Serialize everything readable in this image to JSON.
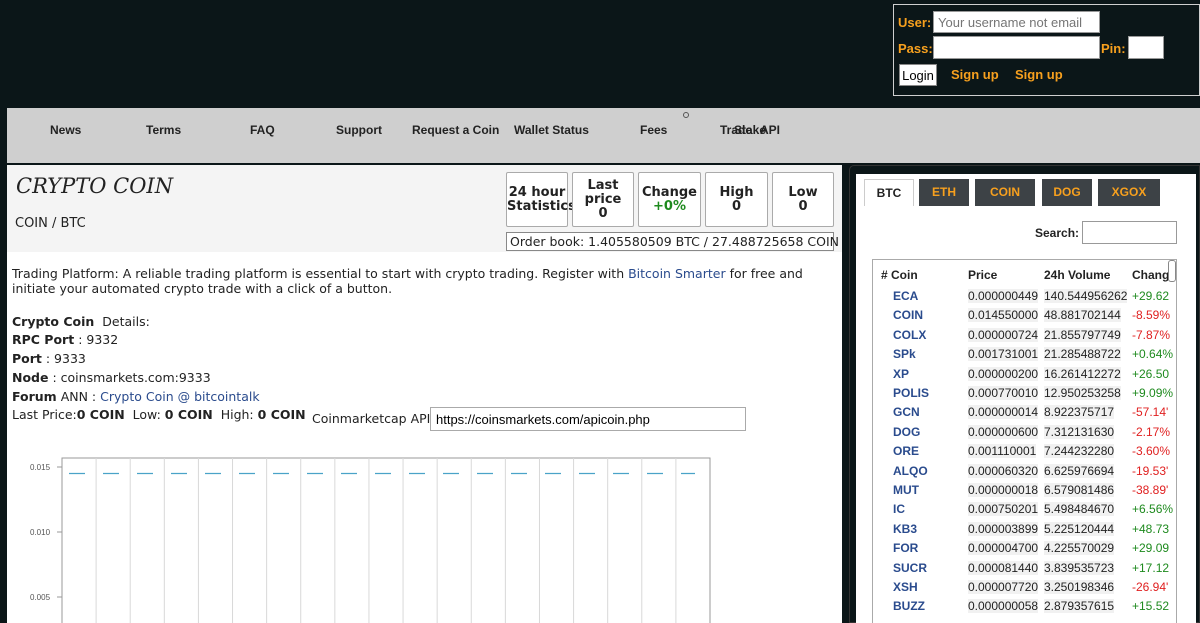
{
  "login": {
    "user_label": "User:",
    "user_placeholder": "Your username not email",
    "pass_label": "Pass:",
    "pin_label": "Pin:",
    "login_button": "Login",
    "signup_link_1": "Sign up",
    "signup_link_2": "Sign up"
  },
  "nav": {
    "items": [
      "News",
      "Terms",
      "FAQ",
      "Support",
      "Request a Coin",
      "Wallet Status",
      "Fees",
      "Trade",
      "Stake",
      "API"
    ]
  },
  "header": {
    "title": "CRYPTO COIN",
    "pair": "COIN / BTC",
    "stats": {
      "s24_line1": "24 hour",
      "s24_line2": "Statistics",
      "last_line1": "Last",
      "last_line2": "price",
      "last_value": "0",
      "change_label": "Change",
      "change_value": "+0%",
      "high_label": "High",
      "high_value": "0",
      "low_label": "Low",
      "low_value": "0"
    },
    "orderbook": "Order book: 1.405580509 BTC / 27.488725658 COIN"
  },
  "description": {
    "text_before": "Trading Platform: A reliable trading platform is essential to start with crypto trading. Register with ",
    "link": "Bitcoin Smarter",
    "text_after": " for free and initiate your automated crypto trade with a click of a button."
  },
  "details": {
    "coin_name": "Crypto Coin",
    "details_label": "Details:",
    "rpc_label": "RPC Port",
    "rpc_value": ": 9332",
    "port_label": "Port",
    "port_value": ": 9333",
    "node_label": "Node",
    "node_value": ": coinsmarkets.com:9333",
    "forum_label": "Forum",
    "forum_ann": "ANN :",
    "forum_link": "Crypto Coin @ bitcointalk",
    "last_price_label": "Last Price:",
    "last_price_value": "0 COIN",
    "low_label": "Low:",
    "low_value": "0 COIN",
    "high_label": "High:",
    "high_value": "0 COIN",
    "cmc_label": "Coinmarketcap API:",
    "cmc_value": "https://coinsmarkets.com/apicoin.php"
  },
  "chart_data": {
    "type": "line",
    "y_ticks": [
      "0.015",
      "0.010",
      "0.005"
    ],
    "ylim": [
      0.0,
      0.016
    ],
    "series": [
      {
        "values": [
          0.0145,
          0.0145
        ]
      }
    ],
    "colors": {
      "line": "#4aa3c8",
      "grid": "#d8d8d8"
    }
  },
  "market": {
    "tabs": [
      "BTC",
      "ETH",
      "COIN",
      "DOG",
      "XGOX"
    ],
    "active_tab": "BTC",
    "search_label": "Search:",
    "columns": [
      "# Coin",
      "Price",
      "24h Volume",
      "Chang"
    ],
    "rows": [
      {
        "coin": "ECA",
        "price": "0.000000449",
        "volume": "140.544956262",
        "change": "+29.62",
        "dir": "pos"
      },
      {
        "coin": "COIN",
        "price": "0.014550000",
        "volume": "48.881702144",
        "change": "-8.59%",
        "dir": "neg"
      },
      {
        "coin": "COLX",
        "price": "0.000000724",
        "volume": "21.855797749",
        "change": "-7.87%",
        "dir": "neg"
      },
      {
        "coin": "SPk",
        "price": "0.001731001",
        "volume": "21.285488722",
        "change": "+0.64%",
        "dir": "pos"
      },
      {
        "coin": "XP",
        "price": "0.000000200",
        "volume": "16.261412272",
        "change": "+26.50",
        "dir": "pos"
      },
      {
        "coin": "POLIS",
        "price": "0.000770010",
        "volume": "12.950253258",
        "change": "+9.09%",
        "dir": "pos"
      },
      {
        "coin": "GCN",
        "price": "0.000000014",
        "volume": "8.922375717",
        "change": "-57.14'",
        "dir": "neg"
      },
      {
        "coin": "DOG",
        "price": "0.000000600",
        "volume": "7.312131630",
        "change": "-2.17%",
        "dir": "neg"
      },
      {
        "coin": "ORE",
        "price": "0.001110001",
        "volume": "7.244232280",
        "change": "-3.60%",
        "dir": "neg"
      },
      {
        "coin": "ALQO",
        "price": "0.000060320",
        "volume": "6.625976694",
        "change": "-19.53'",
        "dir": "neg"
      },
      {
        "coin": "MUT",
        "price": "0.000000018",
        "volume": "6.579081486",
        "change": "-38.89'",
        "dir": "neg"
      },
      {
        "coin": "IC",
        "price": "0.000750201",
        "volume": "5.498484670",
        "change": "+6.56%",
        "dir": "pos"
      },
      {
        "coin": "KB3",
        "price": "0.000003899",
        "volume": "5.225120444",
        "change": "+48.73",
        "dir": "pos"
      },
      {
        "coin": "FOR",
        "price": "0.000004700",
        "volume": "4.225570029",
        "change": "+29.09",
        "dir": "pos"
      },
      {
        "coin": "SUCR",
        "price": "0.000081440",
        "volume": "3.839535723",
        "change": "+17.12",
        "dir": "pos"
      },
      {
        "coin": "XSH",
        "price": "0.000007720",
        "volume": "3.250198346",
        "change": "-26.94'",
        "dir": "neg"
      },
      {
        "coin": "BUZZ",
        "price": "0.000000058",
        "volume": "2.879357615",
        "change": "+15.52",
        "dir": "pos"
      }
    ]
  }
}
